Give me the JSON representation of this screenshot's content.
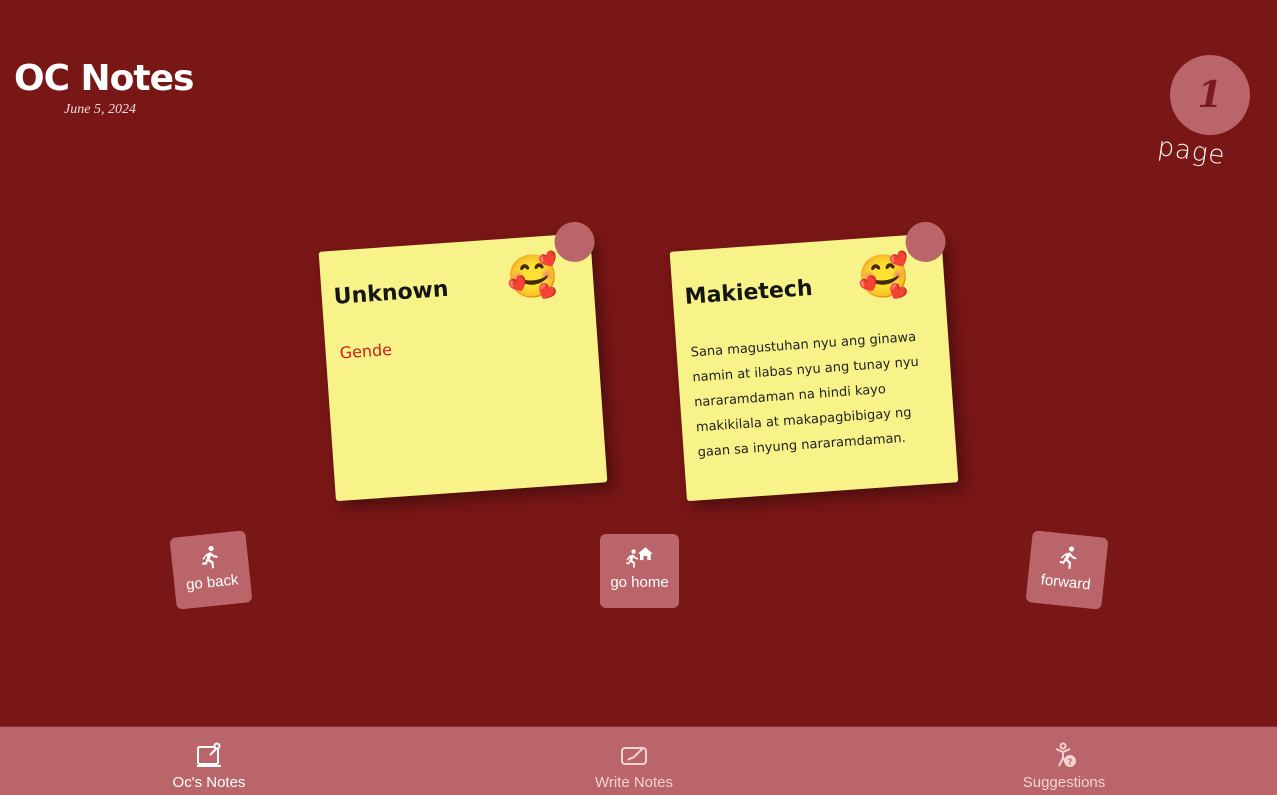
{
  "header": {
    "title": "OC Notes",
    "date": "June 5, 2024"
  },
  "page": {
    "number": "1",
    "label": "page"
  },
  "notes": [
    {
      "title": "Unknown",
      "emoji": "🥰",
      "body": "Gende"
    },
    {
      "title": "Makietech",
      "emoji": "🥰",
      "body": "Sana magustuhan nyu ang ginawa namin at ilabas nyu ang tunay nyu nararamdaman na hindi kayo makikilala at makapagbibigay ng gaan sa inyung nararamdaman."
    }
  ],
  "nav": {
    "back_label": "go back",
    "home_label": "go home",
    "forward_label": "forward"
  },
  "bottom_nav": {
    "items": [
      {
        "label": "Oc's Notes",
        "icon": "notes-icon",
        "active": true
      },
      {
        "label": "Write Notes",
        "icon": "write-icon",
        "active": false
      },
      {
        "label": "Suggestions",
        "icon": "suggestions-icon",
        "active": false
      }
    ]
  },
  "colors": {
    "background": "#791616",
    "accent": "#b96569",
    "note": "#f7f389",
    "note_red_text": "#d21b1b"
  }
}
